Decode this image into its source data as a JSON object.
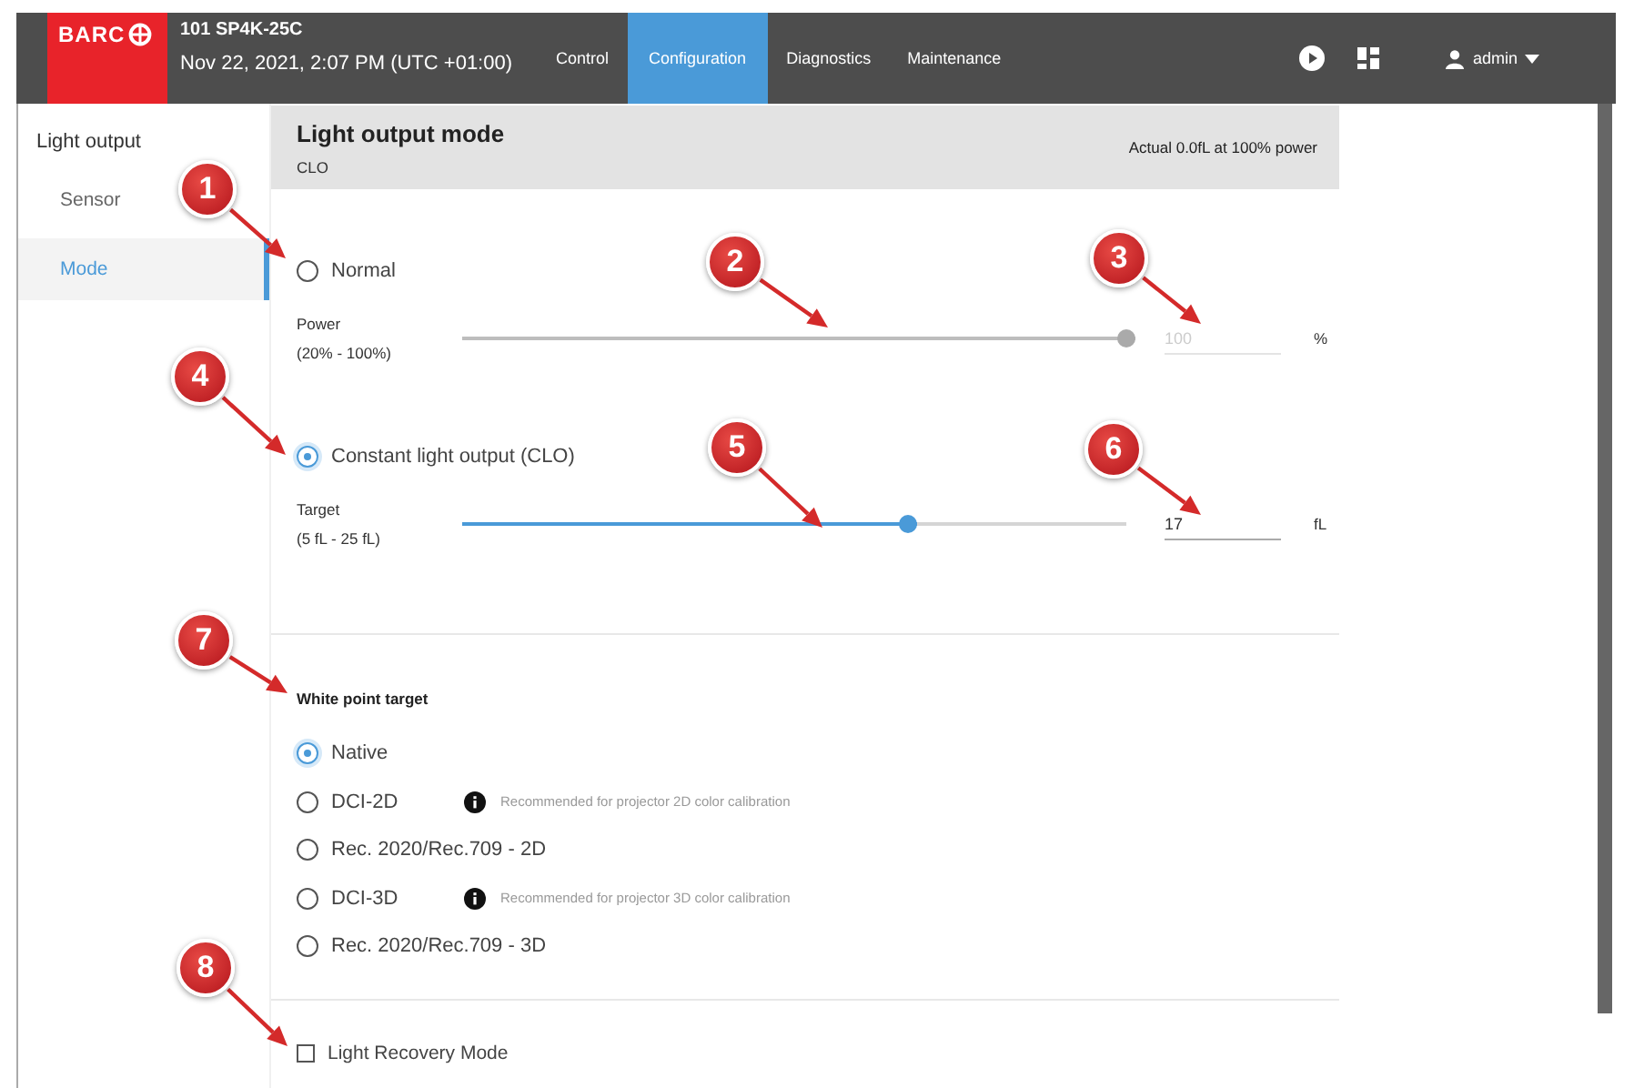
{
  "header": {
    "brand": "BARC",
    "device": "101 SP4K-25C",
    "datetime": "Nov 22, 2021, 2:07 PM (UTC +01:00)",
    "tabs": [
      {
        "label": "Control",
        "selected": false
      },
      {
        "label": "Configuration",
        "selected": true
      },
      {
        "label": "Diagnostics",
        "selected": false
      },
      {
        "label": "Maintenance",
        "selected": false
      }
    ],
    "user": "admin"
  },
  "sidebar": {
    "title": "Light output",
    "items": [
      {
        "label": "Sensor",
        "selected": false
      },
      {
        "label": "Mode",
        "selected": true
      }
    ]
  },
  "panel": {
    "title": "Light output mode",
    "subtitle": "CLO",
    "status": "Actual 0.0fL at 100% power"
  },
  "modes": [
    {
      "label": "Normal",
      "selected": false,
      "slider_label": "Power",
      "range": "(20% - 100%)",
      "level": 1,
      "value": "100",
      "unit": "%",
      "disabled": true
    },
    {
      "label": "Constant light output (CLO)",
      "selected": true,
      "slider_label": "Target",
      "range": "(5 fL - 25 fL)",
      "level": 0.68,
      "value": "17",
      "unit": "fL",
      "disabled": false
    }
  ],
  "white_point": {
    "title": "White point target",
    "options": [
      {
        "label": "Native",
        "selected": true
      },
      {
        "label": "DCI-2D",
        "selected": false,
        "note": "Recommended for projector 2D color calibration"
      },
      {
        "label": "Rec. 2020/Rec.709 - 2D",
        "selected": false
      },
      {
        "label": "DCI-3D",
        "selected": false,
        "note": "Recommended for projector 3D color calibration"
      },
      {
        "label": "Rec. 2020/Rec.709 - 3D",
        "selected": false
      }
    ]
  },
  "light_recovery": {
    "label": "Light Recovery Mode",
    "checked": false
  },
  "callouts": [
    "1",
    "2",
    "3",
    "4",
    "5",
    "6",
    "7",
    "8"
  ]
}
